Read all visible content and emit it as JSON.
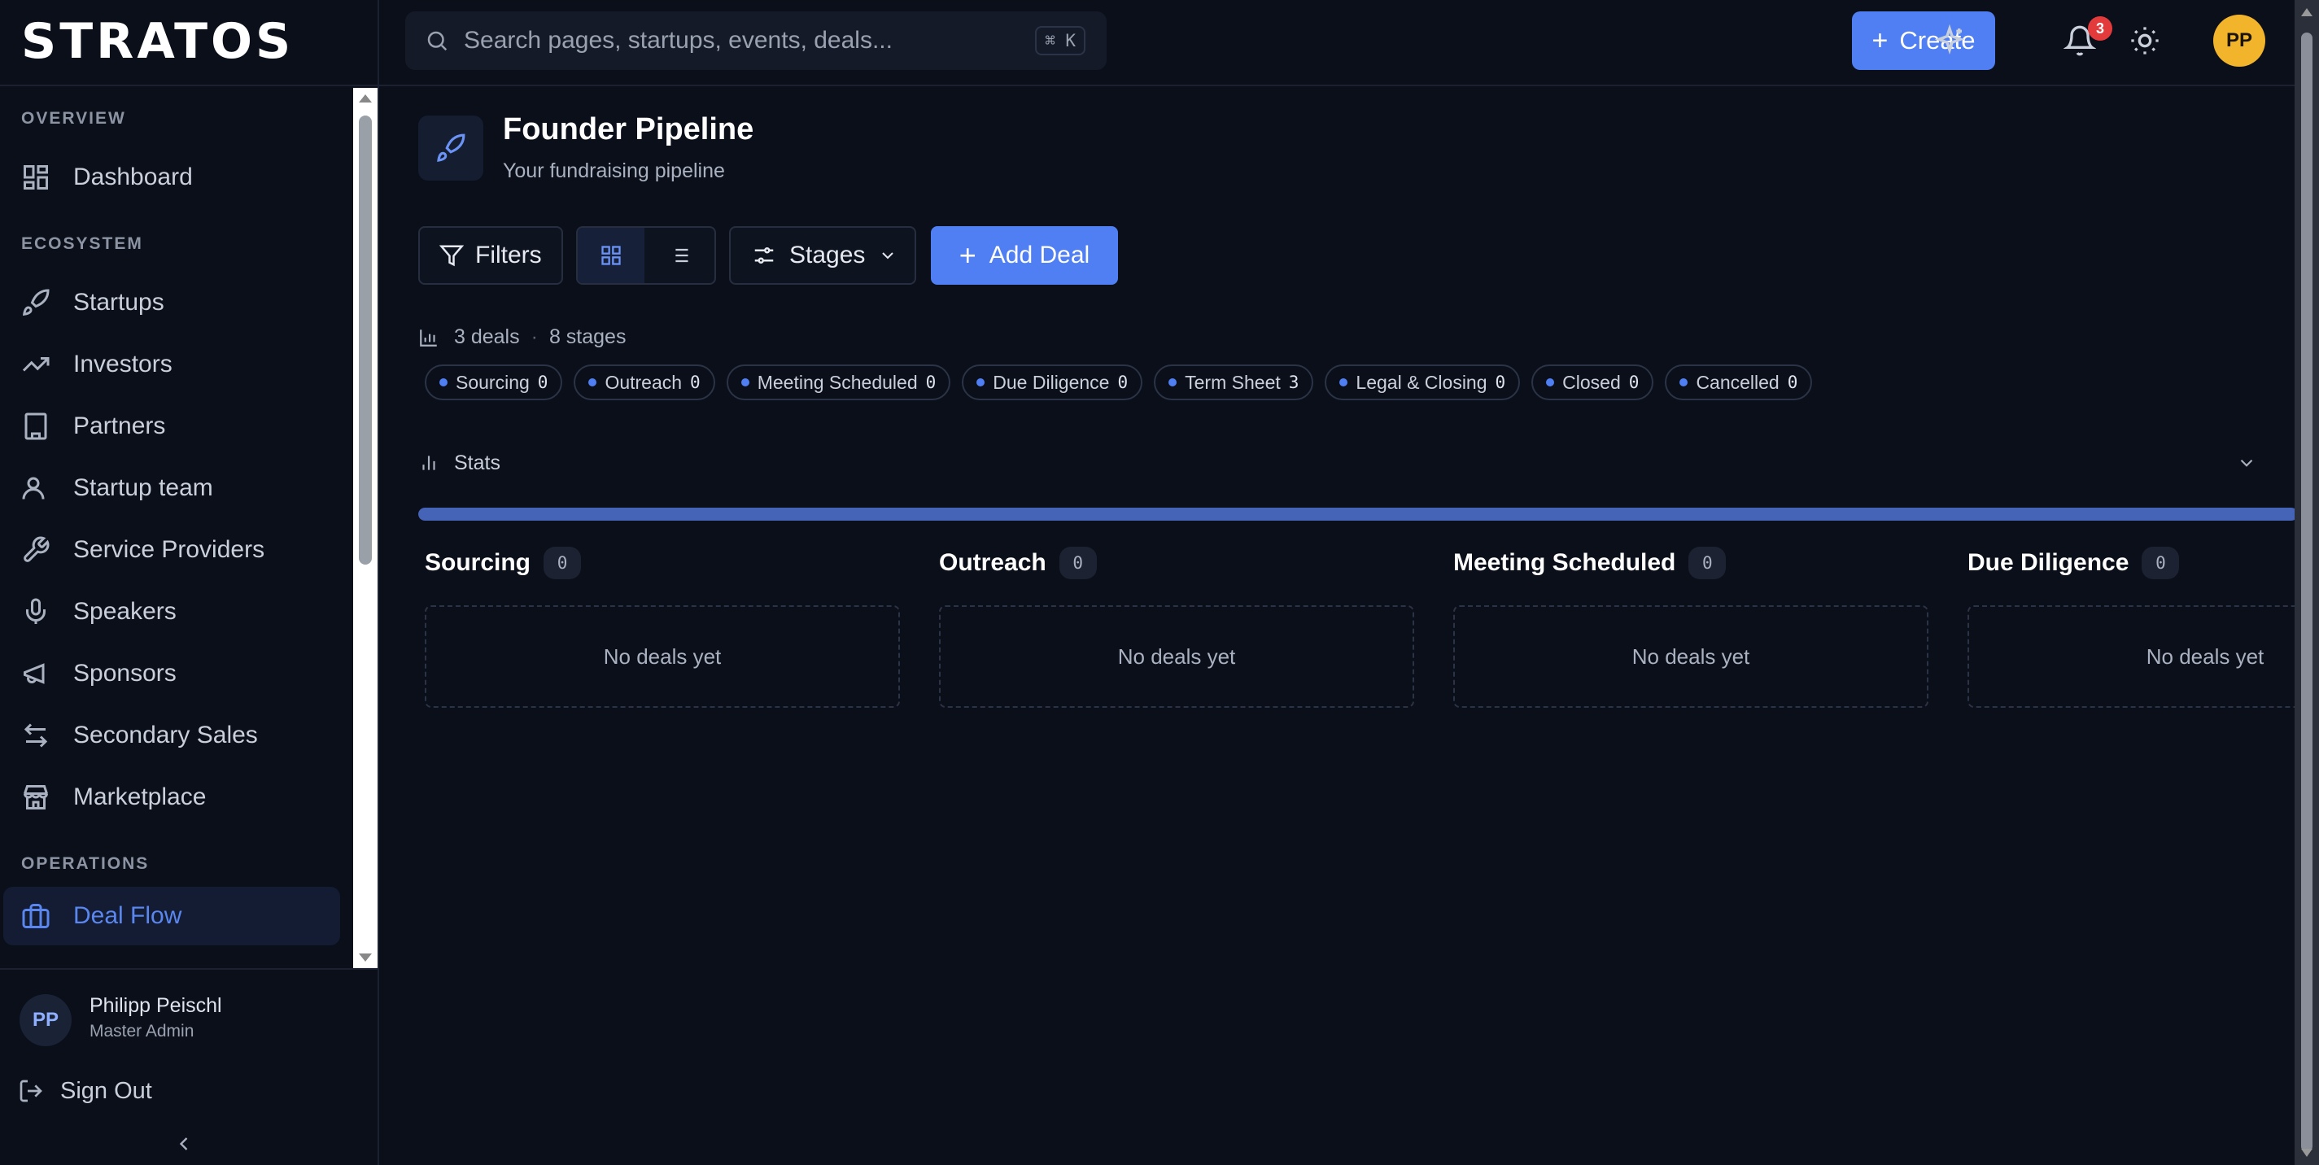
{
  "brand": {
    "name": "STRATOS"
  },
  "sidebar": {
    "sections": [
      {
        "label": "OVERVIEW"
      },
      {
        "label": "ECOSYSTEM"
      },
      {
        "label": "OPERATIONS"
      }
    ],
    "items": [
      {
        "label": "Dashboard",
        "icon": "dashboard-icon"
      },
      {
        "label": "Startups",
        "icon": "rocket-icon"
      },
      {
        "label": "Investors",
        "icon": "trending-up-icon"
      },
      {
        "label": "Partners",
        "icon": "building-icon"
      },
      {
        "label": "Startup team",
        "icon": "user-icon"
      },
      {
        "label": "Service Providers",
        "icon": "wrench-icon"
      },
      {
        "label": "Speakers",
        "icon": "microphone-icon"
      },
      {
        "label": "Sponsors",
        "icon": "megaphone-icon"
      },
      {
        "label": "Secondary Sales",
        "icon": "swap-icon"
      },
      {
        "label": "Marketplace",
        "icon": "store-icon"
      },
      {
        "label": "Deal Flow",
        "icon": "briefcase-icon",
        "active": true
      }
    ],
    "user": {
      "initials": "PP",
      "name": "Philipp Peischl",
      "role": "Master Admin"
    },
    "signout_label": "Sign Out"
  },
  "topbar": {
    "search_placeholder": "Search pages, startups, events, deals...",
    "shortcut": "⌘ K",
    "create_label": "Create",
    "notifications_count": "3",
    "avatar_initials": "PP"
  },
  "page": {
    "title": "Founder Pipeline",
    "subtitle": "Your fundraising pipeline"
  },
  "toolbar": {
    "filters_label": "Filters",
    "stages_label": "Stages",
    "add_deal_label": "Add Deal"
  },
  "summary": {
    "deals": "3 deals",
    "separator": "·",
    "stages": "8 stages"
  },
  "stage_pills": [
    {
      "label": "Sourcing",
      "count": "0"
    },
    {
      "label": "Outreach",
      "count": "0"
    },
    {
      "label": "Meeting Scheduled",
      "count": "0"
    },
    {
      "label": "Due Diligence",
      "count": "0"
    },
    {
      "label": "Term Sheet",
      "count": "3"
    },
    {
      "label": "Legal & Closing",
      "count": "0"
    },
    {
      "label": "Closed",
      "count": "0"
    },
    {
      "label": "Cancelled",
      "count": "0"
    }
  ],
  "stats": {
    "label": "Stats"
  },
  "progress": {
    "fraction": 1.0
  },
  "columns": [
    {
      "title": "Sourcing",
      "count": "0",
      "empty_text": "No deals yet"
    },
    {
      "title": "Outreach",
      "count": "0",
      "empty_text": "No deals yet"
    },
    {
      "title": "Meeting Scheduled",
      "count": "0",
      "empty_text": "No deals yet"
    },
    {
      "title": "Due Diligence",
      "count": "0",
      "empty_text": "No deals yet"
    }
  ],
  "colors": {
    "background": "#0b0f1a",
    "accent": "#4f7ff2",
    "active_nav": "#5a86f0",
    "avatar": "#f2b42b",
    "badge": "#e33b3b"
  }
}
